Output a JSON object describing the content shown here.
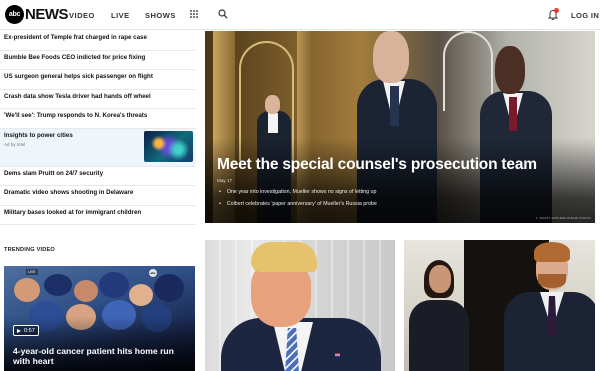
{
  "header": {
    "logo_mark": "abc",
    "logo_text": "NEWS",
    "nav": [
      "VIDEO",
      "LIVE",
      "SHOWS"
    ],
    "login_label": "LOG IN",
    "icons": [
      "grid-menu-icon",
      "search-icon",
      "bell-icon"
    ],
    "accent_color": "#e53935"
  },
  "headlines": [
    "Ex-president of Temple frat charged in rape case",
    "Bumble Bee Foods CEO indicted for price fixing",
    "US surgeon general helps sick passenger on flight",
    "Crash data show Tesla driver had hands off wheel",
    "'We'll see': Trump responds to N. Korea's threats"
  ],
  "ad": {
    "title": "Insights to power cities",
    "byline": "Ad by Intel"
  },
  "headlines_after_ad": [
    "Dems slam Pruitt on 24/7 security",
    "Dramatic video shows shooting in Delaware",
    "Military bases looked at for immigrant children"
  ],
  "hero": {
    "title": "Meet the special counsel's prosecution team",
    "date": "May 17",
    "bullets": [
      "One year into investigation, Mueller shows no signs of letting up",
      "Colbert celebrates 'paper anniversary' of Mueller's Russia probe"
    ],
    "credit": "J. SCOTT APPLEWHITE/AP PHOTO"
  },
  "trending": {
    "label": "TRENDING VIDEO",
    "duration": "0:57",
    "title": "4-year-old cancer patient hits home run with heart",
    "abc_bug": "abc"
  }
}
